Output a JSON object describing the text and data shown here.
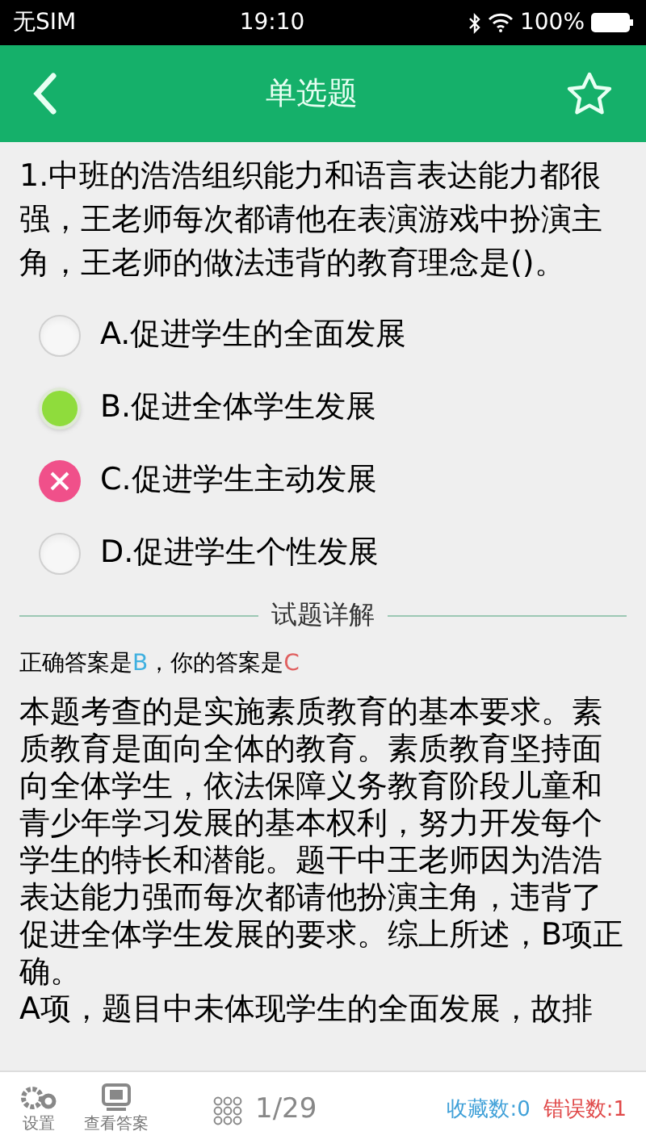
{
  "status_bar": {
    "carrier": "无SIM",
    "time": "19:10",
    "battery": "100%"
  },
  "header": {
    "title": "单选题"
  },
  "question": {
    "text": "1.中班的浩浩组织能力和语言表达能力都很强，王老师每次都请他在表演游戏中扮演主角，王老师的做法违背的教育理念是()。"
  },
  "options": [
    {
      "label": "A.促进学生的全面发展",
      "kind": "none"
    },
    {
      "label": "B.促进全体学生发展",
      "kind": "correct"
    },
    {
      "label": "C.促进学生主动发展",
      "kind": "wrong"
    },
    {
      "label": "D.促进学生个性发展",
      "kind": "none"
    }
  ],
  "detail": {
    "heading": "试题详解",
    "correct_prefix": "正确答案是",
    "correct": "B",
    "separator": "，你的答案是",
    "yours": "C",
    "explanation": "本题考查的是实施素质教育的基本要求。素质教育是面向全体的教育。素质教育坚持面向全体学生，依法保障义务教育阶段儿童和青少年学习发展的基本权利，努力开发每个学生的特长和潜能。题干中王老师因为浩浩表达能力强而每次都请他扮演主角，违背了促进全体学生发展的要求。综上所述，B项正确。",
    "next_line": "A项，题目中未体现学生的全面发展，故排"
  },
  "toolbar": {
    "settings": "设置",
    "view_answer": "查看答案",
    "progress": "1/29",
    "favorites": "收藏数:0",
    "errors": "错误数:1"
  }
}
